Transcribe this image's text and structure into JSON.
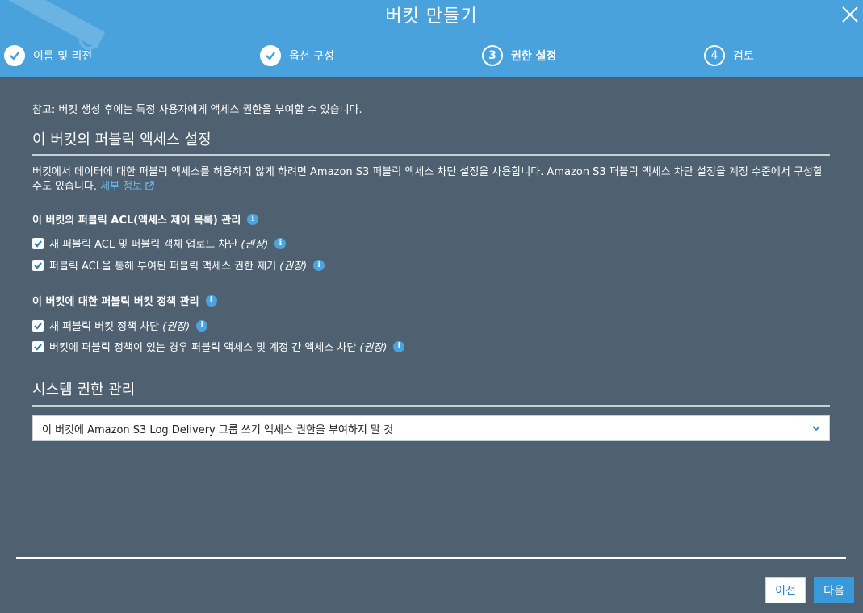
{
  "dialog": {
    "title": "버킷 만들기"
  },
  "steps": [
    {
      "number": "",
      "label": "이름 및 리전",
      "state": "done"
    },
    {
      "number": "",
      "label": "옵션 구성",
      "state": "done"
    },
    {
      "number": "3",
      "label": "권한 설정",
      "state": "active"
    },
    {
      "number": "4",
      "label": "검토",
      "state": "pending"
    }
  ],
  "note": "참고: 버킷 생성 후에는 특정 사용자에게 액세스 권한을 부여할 수 있습니다.",
  "public_access": {
    "heading": "이 버킷의 퍼블릭 액세스 설정",
    "description": "버킷에서 데이터에 대한 퍼블릭 액세스를 허용하지 않게 하려면 Amazon S3 퍼블릭 액세스 차단 설정을 사용합니다. Amazon S3 퍼블릭 액세스 차단 설정을 계정 수준에서 구성할 수도 있습니다.",
    "learn_more": "세부 정보",
    "acl_group": {
      "heading": "이 버킷의 퍼블릭 ACL(액세스 제어 목록) 관리",
      "options": [
        {
          "label": "새 퍼블릭 ACL 및 퍼블릭 객체 업로드 차단",
          "hint": "(권장)",
          "checked": true
        },
        {
          "label": "퍼블릭 ACL을 통해 부여된 퍼블릭 액세스 권한 제거",
          "hint": "(권장)",
          "checked": true
        }
      ]
    },
    "policy_group": {
      "heading": "이 버킷에 대한 퍼블릭 버킷 정책 관리",
      "options": [
        {
          "label": "새 퍼블릭 버킷 정책 차단",
          "hint": "(권장)",
          "checked": true
        },
        {
          "label": "버킷에 퍼블릭 정책이 있는 경우 퍼블릭 액세스 및 계정 간 액세스 차단",
          "hint": "(권장)",
          "checked": true
        }
      ]
    }
  },
  "system_permissions": {
    "heading": "시스템 권한 관리",
    "selected": "이 버킷에 Amazon S3 Log Delivery 그룹 쓰기 액세스 권한을 부여하지 말 것"
  },
  "footer": {
    "prev_label": "이전",
    "next_label": "다음"
  },
  "colors": {
    "header_bg": "#4aa2dc",
    "body_bg": "#4f6170",
    "accent": "#3a9ad9"
  }
}
